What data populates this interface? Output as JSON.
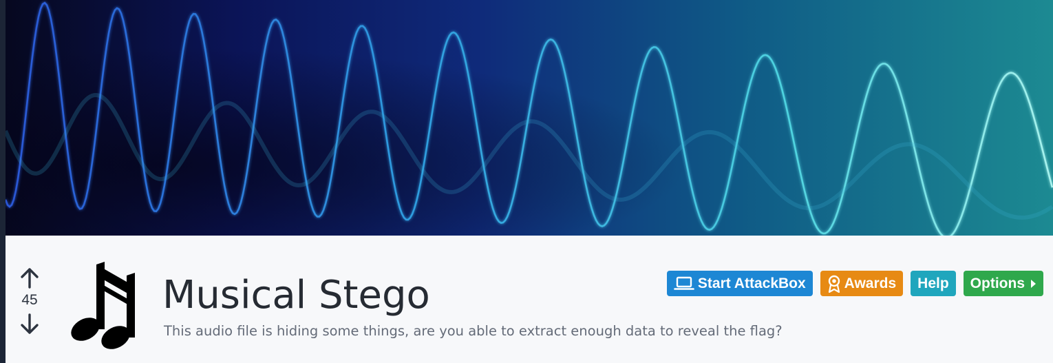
{
  "room": {
    "title": "Musical Stego",
    "description": "This audio file is hiding some things, are you able to extract enough data to reveal the flag?",
    "icon": "music-note-icon"
  },
  "votes": {
    "count": "45",
    "upvote_icon": "arrow-up-icon",
    "downvote_icon": "arrow-down-icon"
  },
  "actions": {
    "start_attackbox": {
      "label": "Start AttackBox",
      "icon": "laptop-icon",
      "color": "#1d87d4"
    },
    "awards": {
      "label": "Awards",
      "icon": "award-ribbon-icon",
      "color": "#e78a14"
    },
    "help": {
      "label": "Help",
      "color": "#20a6bd"
    },
    "options": {
      "label": "Options",
      "icon": "caret-right-icon",
      "color": "#2fa84c"
    }
  },
  "colors": {
    "panel_background": "#f7f8fa",
    "title_text": "#262b33",
    "subtitle_text": "#646b78"
  }
}
